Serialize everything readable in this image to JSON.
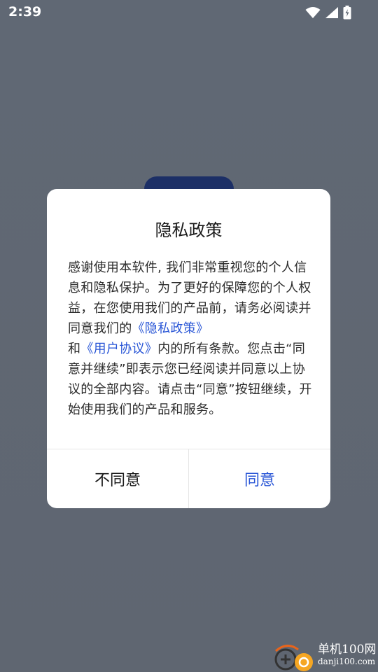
{
  "status_bar": {
    "time": "2:39",
    "icons": [
      "wifi-icon",
      "cellular-signal-icon",
      "battery-charging-icon"
    ]
  },
  "dialog": {
    "title": "隐私政策",
    "body": {
      "p1": "感谢使用本软件, 我们非常重视您的个人信息和隐私保护。为了更好的保障您的个人权益，在您使用我们的产品前，请务必阅读并同意我们的",
      "privacy_link": "《隐私政策》",
      "p2": "和",
      "agreement_link": "《用户协议》",
      "p3": "内的所有条款。您点击“同意并继续”即表示您已经阅读并同意以上协议的全部内容。请点击“同意”按钮继续，开始使用我们的产品和服务。"
    },
    "decline_label": "不同意",
    "agree_label": "同意"
  },
  "watermark": {
    "main": "单机100网",
    "sub": "danji100.com"
  },
  "colors": {
    "link": "#2855d6",
    "scrim": "#606874",
    "dialog_bg": "#ffffff"
  }
}
